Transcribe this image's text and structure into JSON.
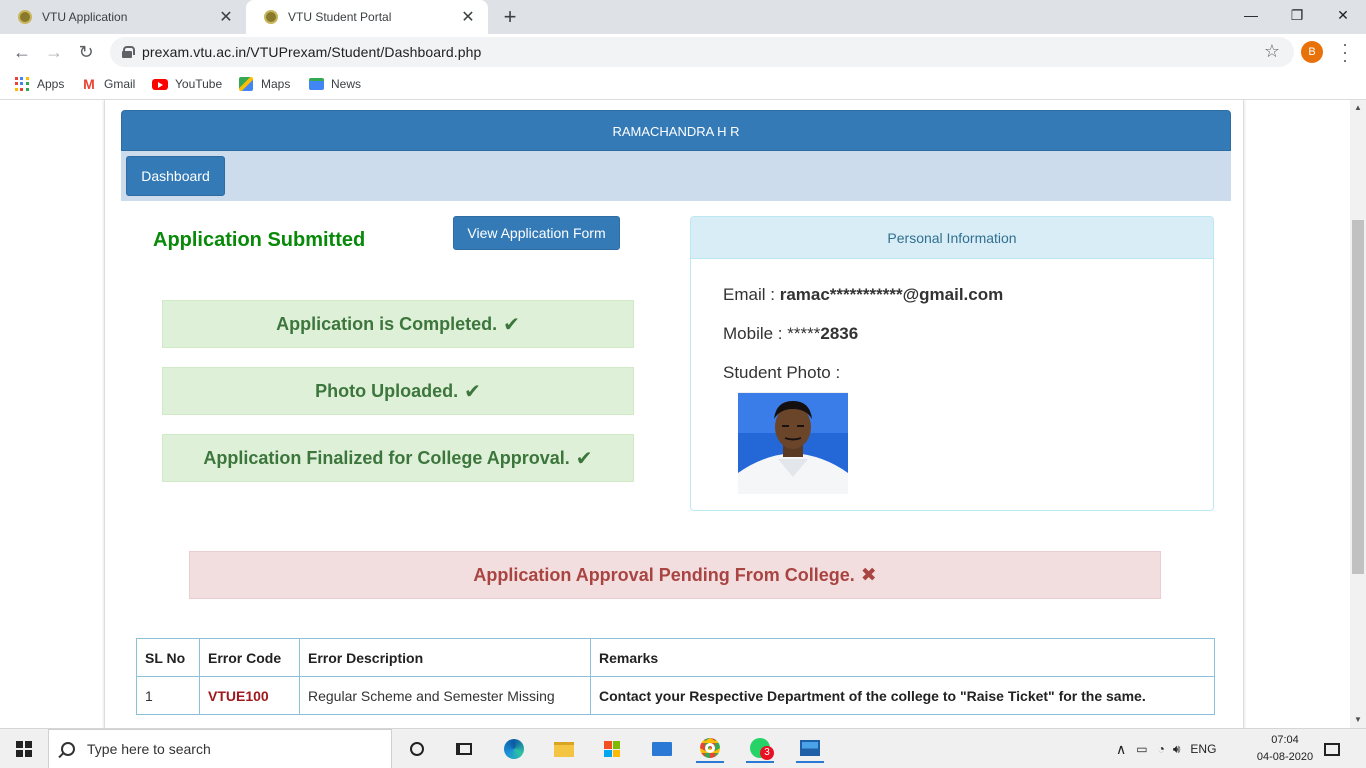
{
  "browser": {
    "tabs": [
      {
        "title": "VTU Application"
      },
      {
        "title": "VTU Student Portal"
      }
    ],
    "url": "prexam.vtu.ac.in/VTUPrexam/Student/Dashboard.php",
    "profile_initial": "B",
    "bookmarks": [
      {
        "label": "Apps"
      },
      {
        "label": "Gmail"
      },
      {
        "label": "YouTube"
      },
      {
        "label": "Maps"
      },
      {
        "label": "News"
      }
    ]
  },
  "page": {
    "student_name": "RAMACHANDRA H R",
    "nav": {
      "dashboard_label": "Dashboard"
    },
    "application_status_title": "Application Submitted",
    "view_form_label": "View Application Form",
    "status_items": [
      {
        "text": "Application is Completed."
      },
      {
        "text": "Photo Uploaded."
      },
      {
        "text": "Application Finalized for College Approval."
      }
    ],
    "personal_info": {
      "heading": "Personal Information",
      "email_label": "Email :",
      "email_value": "ramac***********@gmail.com",
      "mobile_label": "Mobile :",
      "mobile_mask": "*****",
      "mobile_value": "2836",
      "photo_label": "Student Photo :"
    },
    "pending_text": "Application Approval Pending From College.",
    "error_table": {
      "headers": [
        "SL No",
        "Error Code",
        "Error Description",
        "Remarks"
      ],
      "rows": [
        {
          "sl": "1",
          "code": "VTUE100",
          "desc": "Regular Scheme and Semester Missing",
          "remark": "Contact your Respective Department of the college to \"Raise Ticket\" for the same."
        }
      ]
    }
  },
  "taskbar": {
    "search_placeholder": "Type here to search",
    "language": "ENG",
    "time": "07:04",
    "date": "04-08-2020",
    "whatsapp_badge": "3"
  },
  "colors": {
    "primary": "#337ab7",
    "success_bg": "#dff0d8",
    "success_text": "#3c763d",
    "danger_bg": "#f2dede",
    "danger_text": "#a94442",
    "submitted_green": "#088a08"
  }
}
